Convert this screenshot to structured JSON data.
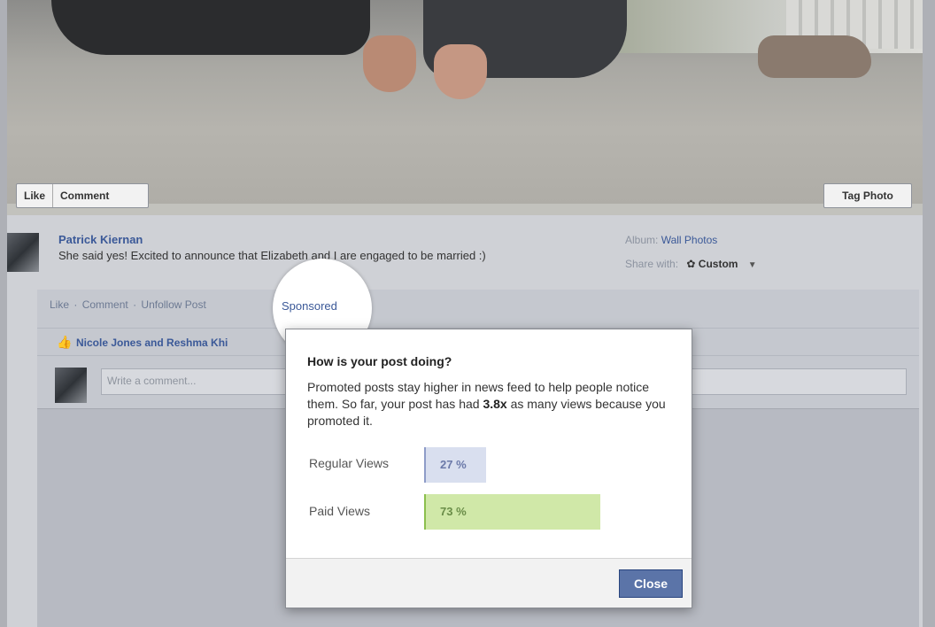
{
  "photo": {
    "like_label": "Like",
    "comment_label": "Comment",
    "tag_label": "Tag Photo"
  },
  "post": {
    "author": "Patrick Kiernan",
    "status": "She said yes! Excited to announce that Elizabeth and I are engaged to be married :)",
    "album_label": "Album:",
    "album_link": "Wall Photos",
    "share_label": "Share with:",
    "share_value": "Custom",
    "share_icon": "gear-icon"
  },
  "ufi": {
    "actions": [
      "Like",
      "Comment",
      "Unfollow Post"
    ],
    "separator": "·",
    "sponsored": "Sponsored",
    "likes_text": "Nicole Jones and Reshma Khi",
    "comment_placeholder": "Write a comment..."
  },
  "popup": {
    "title": "How is your post doing?",
    "body_pre": "Promoted posts stay higher in news feed to help people notice them. So far, your post has had",
    "multiplier": "3.8x",
    "body_post": "as many views because you promoted it.",
    "rows": [
      {
        "label": "Regular Views",
        "value": "27 %",
        "percent": 27,
        "color": "#d9dfef"
      },
      {
        "label": "Paid Views",
        "value": "73 %",
        "percent": 73,
        "color": "#d0e8a8"
      }
    ],
    "close_label": "Close"
  },
  "colors": {
    "link": "#3b5998",
    "button": "#5b74a8"
  }
}
